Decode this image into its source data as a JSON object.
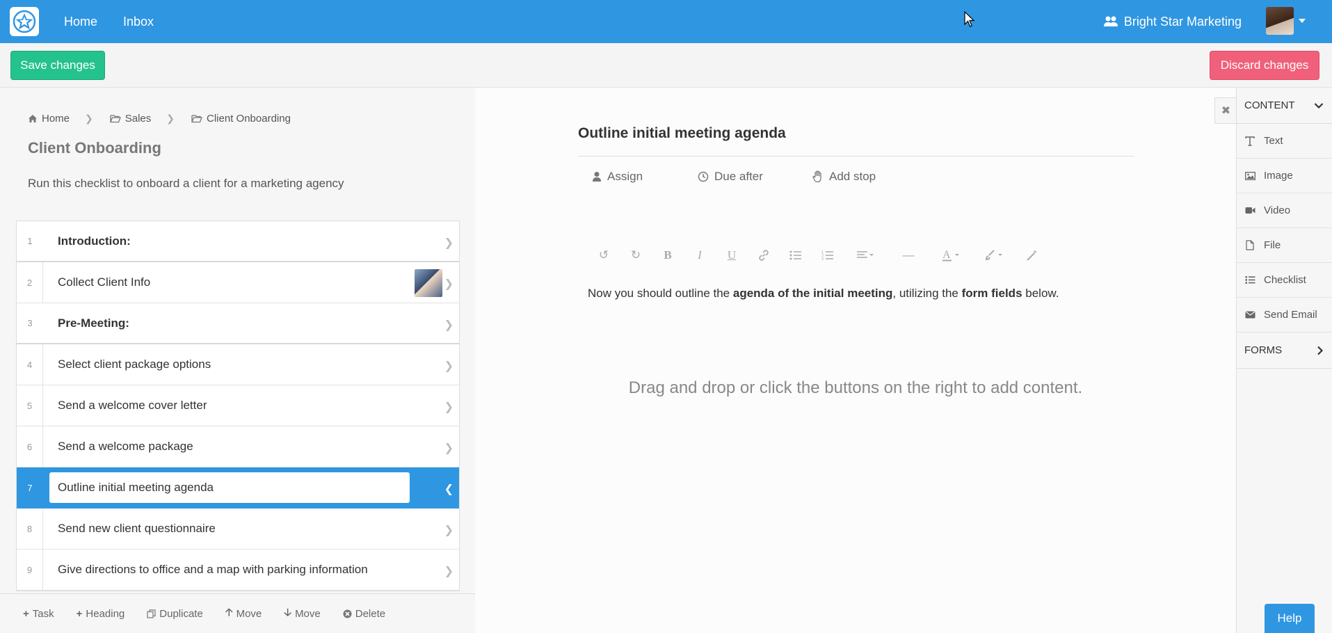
{
  "nav": {
    "links": [
      "Home",
      "Inbox"
    ],
    "org_name": "Bright Star Marketing"
  },
  "actions": {
    "save_label": "Save changes",
    "discard_label": "Discard changes"
  },
  "breadcrumb": [
    "Home",
    "Sales",
    "Client Onboarding"
  ],
  "checklist": {
    "title": "Client Onboarding",
    "description": "Run this checklist to onboard a client for a marketing agency",
    "tasks": [
      {
        "num": "1",
        "label": "Introduction:"
      },
      {
        "num": "2",
        "label": "Collect Client Info"
      },
      {
        "num": "3",
        "label": "Pre-Meeting:"
      },
      {
        "num": "4",
        "label": "Select client package options"
      },
      {
        "num": "5",
        "label": "Send a welcome cover letter"
      },
      {
        "num": "6",
        "label": "Send a welcome package"
      },
      {
        "num": "7",
        "label": "Outline initial meeting agenda"
      },
      {
        "num": "8",
        "label": "Send new client questionnaire"
      },
      {
        "num": "9",
        "label": "Give directions to office and a map with parking information"
      }
    ]
  },
  "bottombar": [
    "Task",
    "Heading",
    "Duplicate",
    "Move",
    "Move",
    "Delete"
  ],
  "editor": {
    "task_title": "Outline initial meeting agenda",
    "assign_label": "Assign",
    "due_label": "Due after",
    "stop_label": "Add stop",
    "body_parts": [
      "Now you should outline the ",
      "agenda of the initial meeting",
      ", utilizing the ",
      "form fields",
      " below."
    ],
    "dropzone_text": "Drag and drop or click the buttons on the right to add content."
  },
  "sidebar": {
    "content_header": "CONTENT",
    "items": [
      "Text",
      "Image",
      "Video",
      "File",
      "Checklist",
      "Send Email"
    ],
    "forms_header": "FORMS"
  },
  "help_label": "Help",
  "colors": {
    "brand_blue": "#2f96e2",
    "save_green": "#24c28c",
    "discard_red": "#f0607a"
  }
}
